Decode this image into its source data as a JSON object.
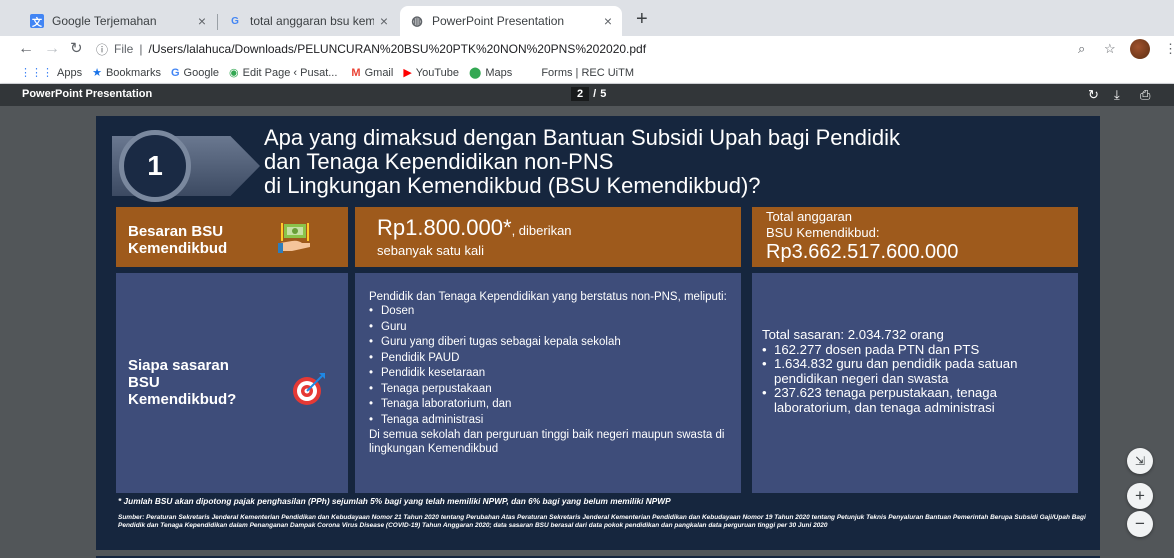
{
  "browser": {
    "tabs": [
      {
        "title": "Google Terjemahan",
        "icon": "google-translate-icon",
        "active": false
      },
      {
        "title": "total anggaran bsu kemdikbud",
        "icon": "google-icon",
        "active": false
      },
      {
        "title": "PowerPoint Presentation",
        "icon": "globe-icon",
        "active": true
      }
    ],
    "address": {
      "scheme_label": "File",
      "url": "/Users/lalahuca/Downloads/PELUNCURAN%20BSU%20PTK%20NON%20PNS%202020.pdf"
    },
    "bookmarks": [
      {
        "label": "Apps",
        "icon": "apps-grid-icon"
      },
      {
        "label": "Bookmarks",
        "icon": "star-icon"
      },
      {
        "label": "Google",
        "icon": "google-icon"
      },
      {
        "label": "Edit Page ‹ Pusat...",
        "icon": "edit-page-icon"
      },
      {
        "label": "Gmail",
        "icon": "gmail-icon"
      },
      {
        "label": "YouTube",
        "icon": "youtube-icon"
      },
      {
        "label": "Maps",
        "icon": "maps-icon"
      },
      {
        "label": "Forms | REC UiTM",
        "icon": "forms-icon"
      }
    ]
  },
  "pdf": {
    "title": "PowerPoint Presentation",
    "current_page": "2",
    "page_sep": "/",
    "total_pages": "5"
  },
  "slide": {
    "number": "1",
    "heading_lines": [
      "Apa yang dimaksud dengan Bantuan Subsidi Upah bagi Pendidik",
      "dan Tenaga Kependidikan non-PNS",
      "di Lingkungan Kemendikbud (BSU Kemendikbud)?"
    ],
    "besaran_label": [
      "Besaran BSU",
      "Kemendikbud"
    ],
    "amount": "Rp1.800.000*",
    "amount_suffix": ", diberikan",
    "amount_sub": "sebanyak satu kali",
    "anggaran_line1": "Total anggaran",
    "anggaran_line2": "BSU Kemendikbud:",
    "anggaran_value": "Rp3.662.517.600.000",
    "sasaran_label": [
      "Siapa sasaran",
      "BSU",
      "Kemendikbud?"
    ],
    "middle_intro": "Pendidik dan Tenaga Kependidikan yang berstatus non-PNS, meliputi:",
    "middle_items": [
      "Dosen",
      "Guru",
      "Guru yang diberi tugas sebagai kepala sekolah",
      "Pendidik PAUD",
      "Pendidik kesetaraan",
      "Tenaga perpustakaan",
      "Tenaga laboratorium, dan",
      "Tenaga administrasi"
    ],
    "middle_outro": "Di semua sekolah dan perguruan tinggi baik negeri maupun swasta di lingkungan Kemendikbud",
    "right_total": "Total sasaran: 2.034.732 orang",
    "right_items": [
      "162.277 dosen pada PTN dan PTS",
      "1.634.832 guru dan pendidik pada satuan pendidikan negeri dan swasta",
      "237.623 tenaga perpustakaan, tenaga laboratorium, dan tenaga administrasi"
    ],
    "footnote": "* Jumlah BSU akan dipotong pajak penghasilan (PPh) sejumlah 5% bagi yang telah memiliki NPWP, dan 6% bagi yang belum memiliki NPWP",
    "source": "Sumber: Peraturan Sekretaris Jenderal Kementerian Pendidikan dan Kebudayaan Nomor 21 Tahun 2020 tentang Perubahan Atas Peraturan Sekretaris Jenderal Kementerian Pendidikan dan Kebudayaan Nomor 19 Tahun 2020 tentang Petunjuk Teknis Penyaluran Bantuan Pemerintah Berupa Subsidi Gaji/Upah Bagi Pendidik dan Tenaga Kependidikan dalam Penanganan Dampak Corona Virus Disease (COVID-19) Tahun Anggaran 2020; data sasaran BSU berasal dari data pokok pendidikan dan pangkalan data perguruan tinggi per 30 Juni 2020"
  },
  "colors": {
    "slide_bg": "#16263e",
    "brown_box": "#9e5a1c",
    "blue_box": "#3e4d7a"
  }
}
